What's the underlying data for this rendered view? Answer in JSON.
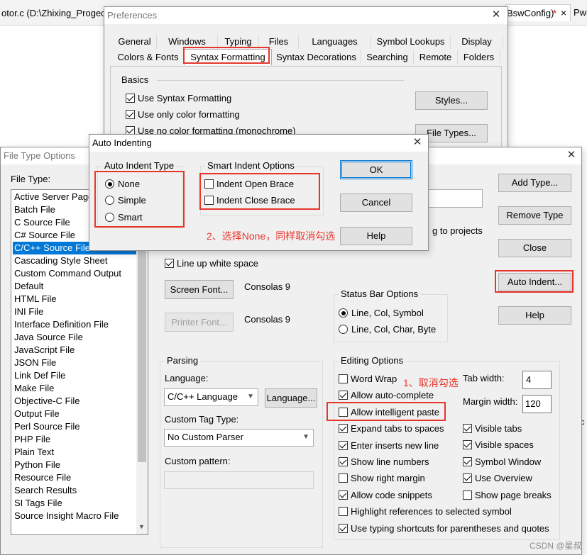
{
  "editor": {
    "tab_left": "otor.c (D:\\Zhixing_Progec",
    "tab_right": "BswConfig)",
    "tab_right_marker": "*",
    "tab_right_close": "×",
    "tab_far_right": "Pwr"
  },
  "preferences": {
    "title": "Preferences",
    "tabs_row1": [
      "General",
      "Windows",
      "Typing",
      "Files",
      "Languages",
      "Symbol Lookups",
      "Display"
    ],
    "tabs_row2": [
      "Colors & Fonts",
      "Syntax Formatting",
      "Syntax Decorations",
      "Searching",
      "Remote",
      "Folders"
    ],
    "active_tab": "Syntax Formatting",
    "basics_label": "Basics",
    "checks": [
      {
        "label": "Use Syntax Formatting",
        "checked": true
      },
      {
        "label": "Use only color formatting",
        "checked": true
      },
      {
        "label": "Use no color formatting (monochrome)",
        "checked": true
      }
    ],
    "styles_button": "Styles...",
    "file_types_button": "File Types..."
  },
  "file_type_options": {
    "title": "File Type Options",
    "file_type_label": "File Type:",
    "file_types": [
      "Active Server Page",
      "Batch File",
      "C Source File",
      "C# Source File",
      "C/C++ Source File",
      "Cascading Style Sheet",
      "Custom Command Output",
      "Default",
      "HTML File",
      "INI File",
      "Interface Definition File",
      "Java Source File",
      "JavaScript File",
      "JSON File",
      "Link Def File",
      "Make File",
      "Objective-C File",
      "Output File",
      "Perl Source File",
      "PHP File",
      "Plain Text",
      "Python File",
      "Resource File",
      "Search Results",
      "SI Tags File",
      "Source Insight Macro File"
    ],
    "selected_file_type": "C/C++ Source File",
    "add_type": "Add Type...",
    "remove_type": "Remove Type",
    "close": "Close",
    "auto_indent": "Auto Indent...",
    "help": "Help",
    "projects_fragment": "g to projects",
    "line_up_white_space": "Line up white space",
    "screen_font_button": "Screen Font...",
    "screen_font_value": "Consolas 9",
    "printer_font_button": "Printer Font...",
    "printer_font_value": "Consolas 9",
    "status_bar_group": "Status Bar Options",
    "status_options": [
      {
        "label": "Line, Col, Symbol",
        "selected": true
      },
      {
        "label": "Line, Col, Char, Byte",
        "selected": false
      }
    ],
    "parsing_group": "Parsing",
    "language_label": "Language:",
    "language_value": "C/C++ Language",
    "language_button": "Language...",
    "custom_tag_label": "Custom Tag Type:",
    "custom_tag_value": "No Custom Parser",
    "custom_pattern_label": "Custom pattern:",
    "editing_group": "Editing Options",
    "editing_left": [
      {
        "label": "Word Wrap",
        "checked": false
      },
      {
        "label": "Allow auto-complete",
        "checked": true
      },
      {
        "label": "Allow intelligent paste",
        "checked": false
      },
      {
        "label": "Expand tabs to spaces",
        "checked": true
      },
      {
        "label": "Enter inserts new line",
        "checked": true
      },
      {
        "label": "Show line numbers",
        "checked": true
      },
      {
        "label": "Show right margin",
        "checked": false
      },
      {
        "label": "Allow code snippets",
        "checked": true
      }
    ],
    "editing_right": [
      {
        "label": "Visible tabs",
        "checked": true
      },
      {
        "label": "Visible spaces",
        "checked": true
      },
      {
        "label": "Symbol Window",
        "checked": true
      },
      {
        "label": "Use Overview",
        "checked": true
      },
      {
        "label": "Show page breaks",
        "checked": false
      }
    ],
    "editing_bottom": [
      {
        "label": "Highlight references to selected symbol",
        "checked": false
      },
      {
        "label": "Use typing shortcuts for parentheses and quotes",
        "checked": true
      }
    ],
    "tab_width_label": "Tab width:",
    "tab_width_value": "4",
    "margin_width_label": "Margin width:",
    "margin_width_value": "120"
  },
  "auto_indenting": {
    "title": "Auto Indenting",
    "type_group": "Auto Indent Type",
    "types": [
      {
        "label": "None",
        "selected": true
      },
      {
        "label": "Simple",
        "selected": false
      },
      {
        "label": "Smart",
        "selected": false
      }
    ],
    "smart_group": "Smart Indent Options",
    "smart_options": [
      {
        "label": "Indent Open Brace",
        "checked": false
      },
      {
        "label": "Indent Close Brace",
        "checked": false
      }
    ],
    "ok": "OK",
    "cancel": "Cancel",
    "help": "Help"
  },
  "annotations": {
    "note1": "1、取消勾选",
    "note2": "2、选择None，同样取消勾选",
    "color": "#e8352b"
  },
  "watermark": "CSDN @星叔"
}
